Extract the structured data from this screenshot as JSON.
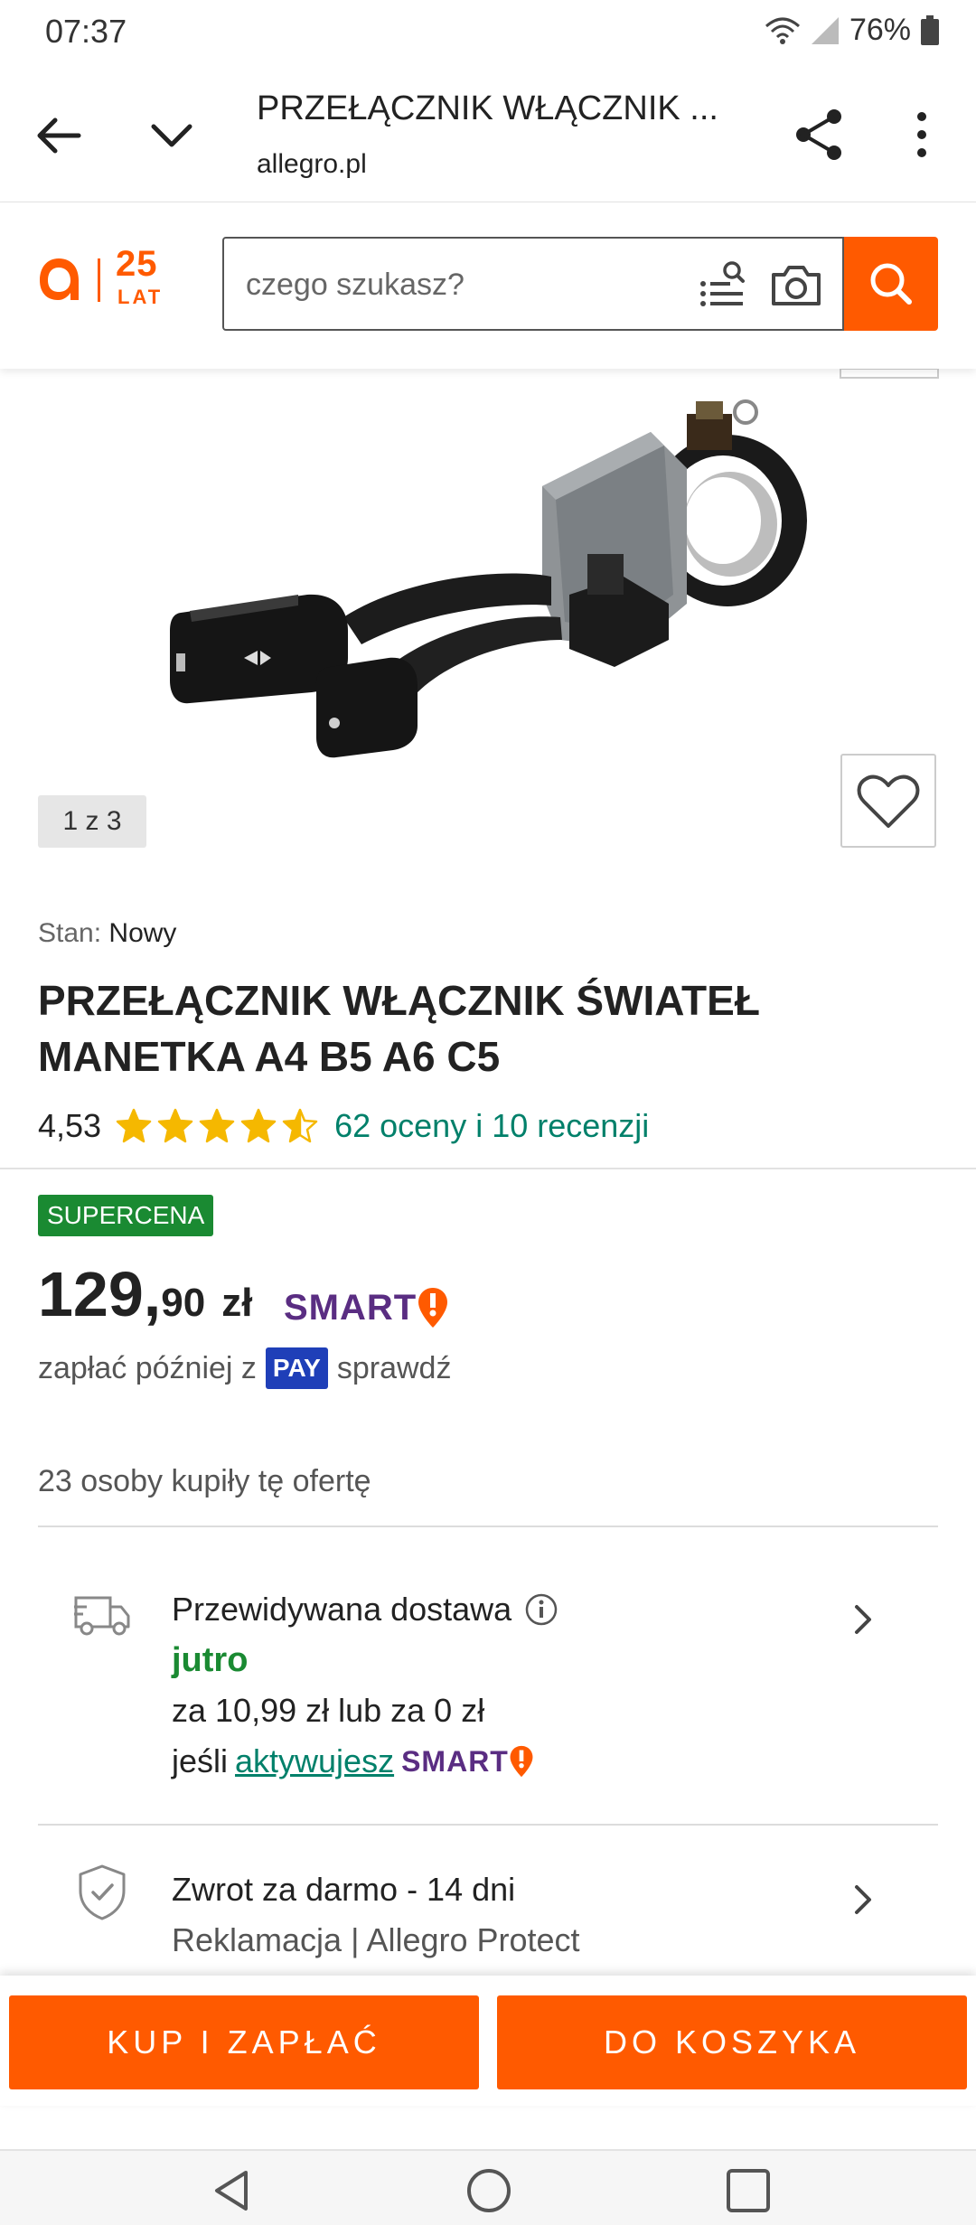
{
  "status_bar": {
    "time": "07:37",
    "battery": "76%"
  },
  "browser": {
    "title": "PRZEŁĄCZNIK WŁĄCZNIK ...",
    "url": "allegro.pl"
  },
  "header": {
    "logo_years": "25",
    "logo_lat": "LAT",
    "search_placeholder": "czego szukasz?"
  },
  "gallery": {
    "counter": "1 z 3"
  },
  "product": {
    "condition_label": "Stan:",
    "condition_value": "Nowy",
    "title": "PRZEŁĄCZNIK WŁĄCZNIK ŚWIATEŁ MANETKA A4 B5 A6 C5",
    "rating": "4,53",
    "rating_stars": 4.53,
    "reviews_link": "62 oceny i 10 recenzji"
  },
  "pricing": {
    "badge": "SUPERCENA",
    "price_int": "129,",
    "price_dec": "90",
    "currency": "zł",
    "smart_label": "SMART",
    "pay_later_prefix": "zapłać później z",
    "pay_badge": "PAY",
    "pay_later_suffix": "sprawdź",
    "buyers": "23 osoby kupiły tę ofertę"
  },
  "delivery": {
    "title": "Przewidywana dostawa",
    "when": "jutro",
    "price": "za 10,99 zł lub za 0 zł",
    "cond_prefix": "jeśli",
    "cond_link": "aktywujesz",
    "smart_label": "SMART"
  },
  "returns": {
    "title": "Zwrot za darmo - 14 dni",
    "subtitle": "Reklamacja | Allegro Protect"
  },
  "actions": {
    "buy": "KUP I ZAPŁAĆ",
    "cart": "DO KOSZYKA"
  },
  "colors": {
    "brand_orange": "#ff5a00",
    "supercena_green": "#1a8a32",
    "link_teal": "#00806a",
    "smart_purple": "#5a2d82",
    "pay_blue": "#1f3fb8",
    "star_yellow": "#f5b800"
  }
}
